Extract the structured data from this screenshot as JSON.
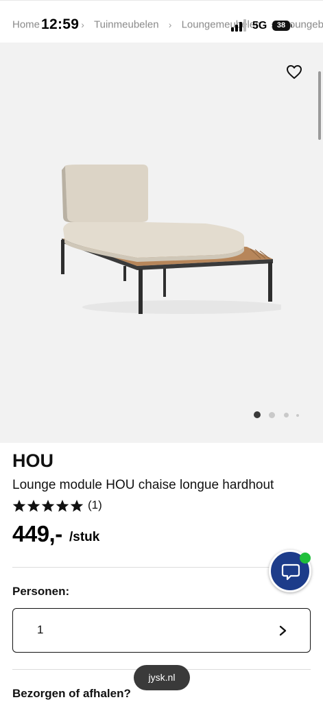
{
  "status_bar": {
    "time": "12:59",
    "network": "5G",
    "battery": "38"
  },
  "breadcrumb": {
    "items": [
      "Home",
      "Tuinmeubelen",
      "Loungemeubelen",
      "Loungeb"
    ]
  },
  "gallery": {
    "favorite_icon": "heart-outline-icon",
    "image_alt": "lounge chaise longue product photo",
    "dots_count": 4,
    "active_dot": 0
  },
  "product": {
    "brand": "HOU",
    "name": "Lounge module HOU chaise longue hardhout",
    "rating": 5,
    "review_count": "(1)",
    "price": "449,-",
    "price_unit": "/stuk"
  },
  "persons": {
    "label": "Personen:",
    "value": "1"
  },
  "delivery": {
    "label": "Bezorgen of afhalen?"
  },
  "browser": {
    "url": "jysk.nl"
  },
  "colors": {
    "chat_button": "#1d3c8a",
    "online": "#1fbf3a",
    "gallery_bg": "#f2f2f2"
  }
}
